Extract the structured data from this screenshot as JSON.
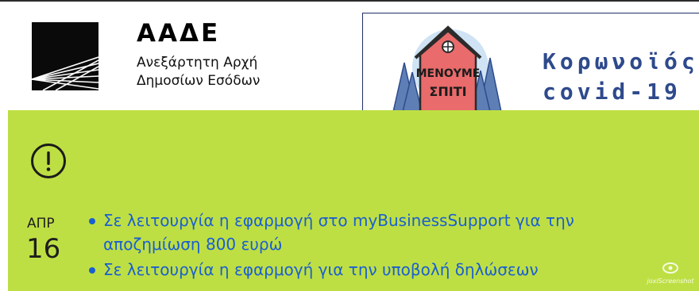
{
  "header": {
    "brand_name": "ΑΑΔΕ",
    "brand_subtitle_line1": "Ανεξάρτητη Αρχή",
    "brand_subtitle_line2": "Δημοσίων Εσόδων",
    "banner": {
      "art_text_line1": "ΜΕΝΟΥΜΕ",
      "art_text_line2": "ΣΠΙΤΙ",
      "title_line1": "Κορωνοϊός",
      "title_line2": "covid-19"
    }
  },
  "notice": {
    "icon": "exclamation-circle-icon",
    "date": {
      "month": "ΑΠΡ",
      "day": "16"
    },
    "items": [
      {
        "text": "Σε λειτουργία η εφαρμογή στο myBusinessSupport για την αποζημίωση 800 ευρώ"
      },
      {
        "text": "Σε λειτουργία η εφαρμογή για την υποβολή δηλώσεων"
      }
    ]
  },
  "watermark": {
    "text": "joxiScreenshot",
    "icon": "joxi-logo-icon"
  },
  "colors": {
    "notice_background": "#bedf43",
    "link": "#1a5fd1",
    "banner_border": "#1f2f6a",
    "banner_title": "#2e4a8c",
    "banner_house": "#e96b6b"
  }
}
